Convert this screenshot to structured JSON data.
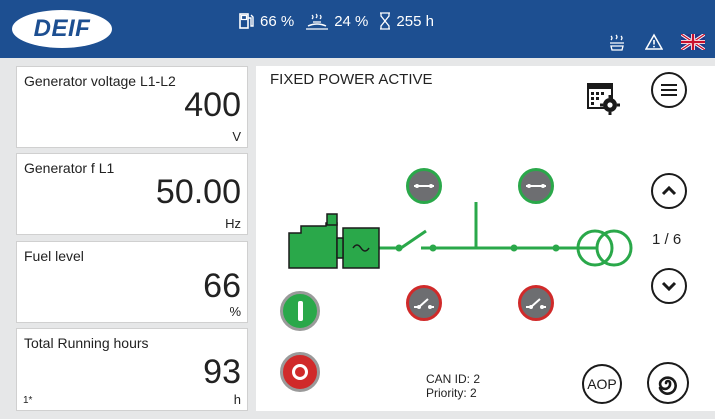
{
  "header": {
    "logo_text": "DEIF",
    "fuel_pct": "66 %",
    "service_pct": "24 %",
    "hours": "255 h",
    "icons": [
      "fuel-icon",
      "service-icon",
      "hourglass-icon",
      "heater-icon",
      "warning-icon",
      "uk-flag-icon"
    ]
  },
  "panels": [
    {
      "label": "Generator voltage L1-L2",
      "value": "400",
      "unit": "V"
    },
    {
      "label": "Generator f L1",
      "value": "50.00",
      "unit": "Hz"
    },
    {
      "label": "Fuel level",
      "value": "66",
      "unit": "%"
    },
    {
      "label": "Total Running hours",
      "value": "93",
      "unit": "h",
      "footnote": "1*"
    }
  ],
  "diagram": {
    "mode_text": "FIXED POWER   ACTIVE",
    "can_id": "CAN ID: 2",
    "priority": "Priority: 2"
  },
  "controls": {
    "page_indicator": "1 / 6",
    "aop_label": "AOP"
  },
  "colors": {
    "header_bg": "#1d4f91",
    "green": "#2aa84a",
    "red": "#d02a2a",
    "breaker_grey": "#6d6e71"
  }
}
